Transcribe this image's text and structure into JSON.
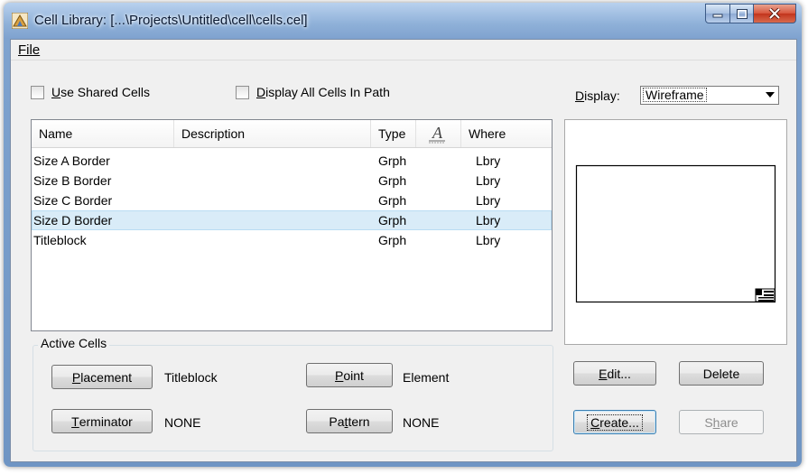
{
  "window": {
    "title": "Cell Library: [...\\Projects\\Untitled\\cell\\cells.cel]"
  },
  "menu": {
    "file": "File"
  },
  "options": {
    "use_shared_cells": {
      "prefix": "",
      "mnemonic": "U",
      "rest": "se Shared Cells",
      "checked": false
    },
    "display_all_cells": {
      "prefix": "",
      "mnemonic": "D",
      "rest": "isplay All Cells In Path",
      "checked": false
    }
  },
  "display": {
    "prefix": "",
    "mnemonic": "D",
    "rest": "isplay:",
    "value": "Wireframe"
  },
  "list": {
    "columns": [
      "Name",
      "Description",
      "Type",
      "",
      "Where"
    ],
    "rows": [
      {
        "name": "Size A Border",
        "description": "",
        "type": "Grph",
        "where": "Lbry"
      },
      {
        "name": "Size B Border",
        "description": "",
        "type": "Grph",
        "where": "Lbry"
      },
      {
        "name": "Size C Border",
        "description": "",
        "type": "Grph",
        "where": "Lbry"
      },
      {
        "name": "Size D Border",
        "description": "",
        "type": "Grph",
        "where": "Lbry"
      },
      {
        "name": "Titleblock",
        "description": "",
        "type": "Grph",
        "where": "Lbry"
      }
    ],
    "selected_row": "Size D Border"
  },
  "active_cells": {
    "label": "Active Cells",
    "placement": {
      "m": "P",
      "r": "lacement",
      "value": "Titleblock"
    },
    "point": {
      "m": "P",
      "r": "oint",
      "value": "Element"
    },
    "terminator": {
      "m": "T",
      "r": "erminator",
      "value": "NONE"
    },
    "pattern": {
      "p": "Pa",
      "m": "t",
      "r": "tern",
      "value": "NONE"
    }
  },
  "buttons": {
    "edit": {
      "m": "E",
      "r": "dit..."
    },
    "delete": {
      "label": "Delete"
    },
    "create": {
      "m": "C",
      "r": "reate..."
    },
    "share": {
      "p": "S",
      "m": "h",
      "r": "are"
    }
  },
  "colors": {
    "selection": "#d9ecf8",
    "close_button": "#c2341c",
    "title_bar": "#8eb0d8"
  }
}
